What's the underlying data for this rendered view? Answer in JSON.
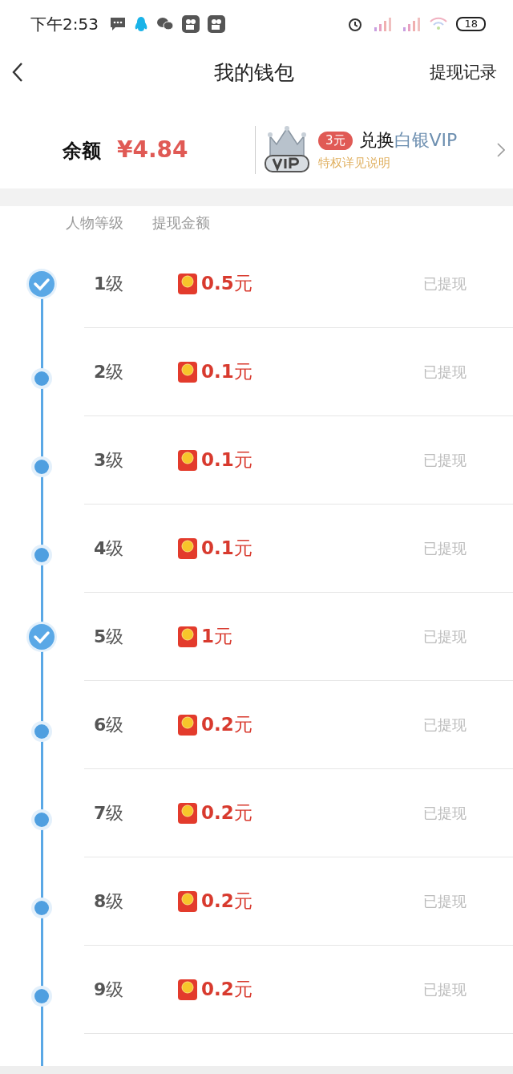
{
  "status_bar": {
    "time": "下午2:53",
    "battery": "18"
  },
  "header": {
    "title": "我的钱包",
    "action": "提现记录"
  },
  "balance": {
    "label": "余额",
    "amount": "¥4.84"
  },
  "vip": {
    "badge": "3元",
    "prefix": "兑换",
    "highlight": "白银VIP",
    "subtitle": "特权详见说明"
  },
  "columns": [
    "人物等级",
    "提现金额"
  ],
  "rows": [
    {
      "level": "**1**级",
      "amount": "**0.5**元",
      "status": "已提现",
      "checked": true
    },
    {
      "level": "**2**级",
      "amount": "**0.1**元",
      "status": "已提现",
      "checked": false
    },
    {
      "level": "**3**级",
      "amount": "**0.1**元",
      "status": "已提现",
      "checked": false
    },
    {
      "level": "**4**级",
      "amount": "**0.1**元",
      "status": "已提现",
      "checked": false
    },
    {
      "level": "**5**级",
      "amount": "**1**元",
      "status": "已提现",
      "checked": true
    },
    {
      "level": "**6**级",
      "amount": "**0.2**元",
      "status": "已提现",
      "checked": false
    },
    {
      "level": "**7**级",
      "amount": "**0.2**元",
      "status": "已提现",
      "checked": false
    },
    {
      "level": "**8**级",
      "amount": "**0.2**元",
      "status": "已提现",
      "checked": false
    },
    {
      "level": "**9**级",
      "amount": "**0.2**元",
      "status": "已提现",
      "checked": false
    }
  ]
}
